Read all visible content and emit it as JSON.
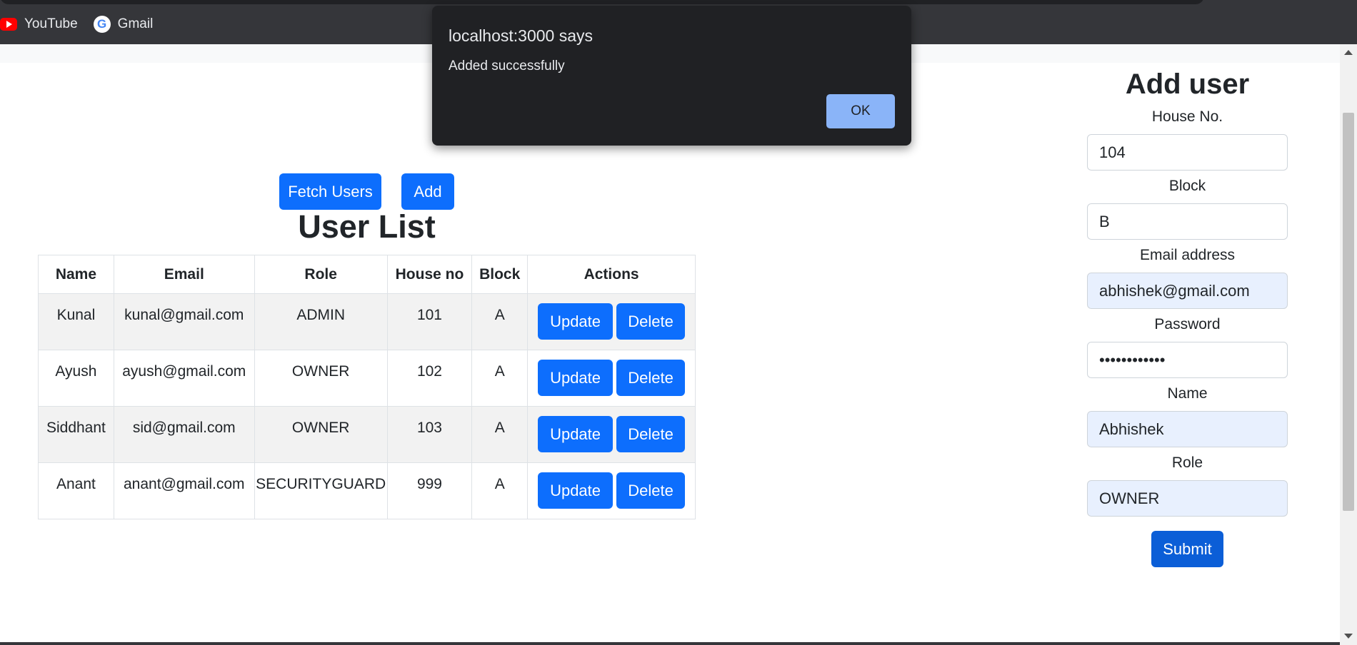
{
  "bookmarks": [
    {
      "label": "YouTube",
      "icon": "youtube-icon"
    },
    {
      "label": "Gmail",
      "icon": "google-icon"
    }
  ],
  "toolbar": {
    "fetch_label": "Fetch Users",
    "add_label": "Add"
  },
  "user_list": {
    "title": "User List",
    "columns": [
      "Name",
      "Email",
      "Role",
      "House no",
      "Block",
      "Actions"
    ],
    "rows": [
      {
        "name": "Kunal",
        "email": "kunal@gmail.com",
        "role": "ADMIN",
        "house": "101",
        "block": "A"
      },
      {
        "name": "Ayush",
        "email": "ayush@gmail.com",
        "role": "OWNER",
        "house": "102",
        "block": "A"
      },
      {
        "name": "Siddhant",
        "email": "sid@gmail.com",
        "role": "OWNER",
        "house": "103",
        "block": "A"
      },
      {
        "name": "Anant",
        "email": "anant@gmail.com",
        "role": "SECURITYGUARD",
        "house": "999",
        "block": "A"
      }
    ],
    "update_label": "Update",
    "delete_label": "Delete"
  },
  "add_user": {
    "title": "Add user",
    "fields": [
      {
        "label": "House No.",
        "value": "104"
      },
      {
        "label": "Block",
        "value": "B"
      },
      {
        "label": "Email address",
        "value": "abhishek@gmail.com"
      },
      {
        "label": "Password",
        "value": "••••••••••••"
      },
      {
        "label": "Name",
        "value": "Abhishek"
      },
      {
        "label": "Role",
        "value": "OWNER"
      }
    ],
    "submit_label": "Submit"
  },
  "dialog": {
    "title": "localhost:3000 says",
    "message": "Added successfully",
    "ok_label": "OK"
  },
  "colors": {
    "primary": "#0d6efd",
    "dialog_bg": "#202124",
    "dialog_ok": "#8ab4f8",
    "autofill_bg": "#e8f0fe"
  }
}
